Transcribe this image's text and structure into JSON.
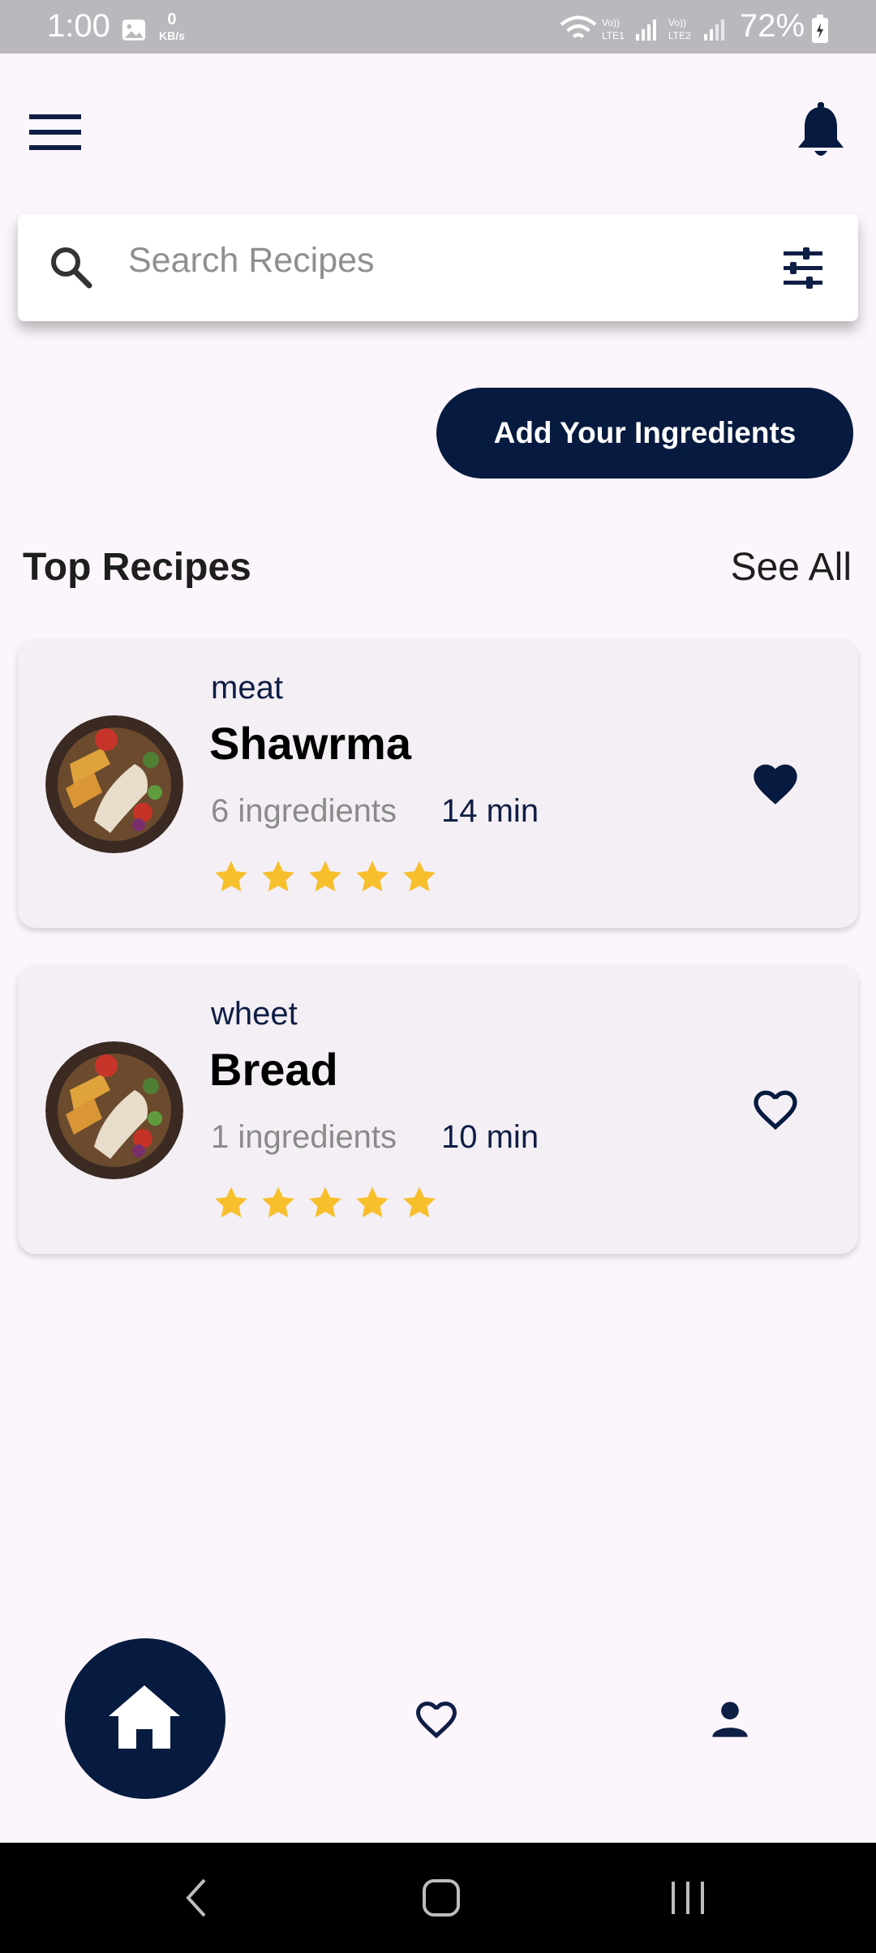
{
  "status_bar": {
    "time": "1:00",
    "kbs_value": "0",
    "kbs_unit": "KB/s",
    "battery": "72%"
  },
  "search": {
    "placeholder": "Search Recipes"
  },
  "actions": {
    "add_ingredients": "Add Your Ingredients"
  },
  "section": {
    "title": "Top Recipes",
    "see_all": "See All"
  },
  "recipes": [
    {
      "category": "meat",
      "name": "Shawrma",
      "ingredients": "6 ingredients",
      "time": "14 min",
      "rating": 5,
      "favorite": true
    },
    {
      "category": "wheet",
      "name": "Bread",
      "ingredients": "1 ingredients",
      "time": "10 min",
      "rating": 5,
      "favorite": false
    }
  ],
  "colors": {
    "primary": "#071a3f",
    "star": "#f8bf2d",
    "background": "#fcf6fc",
    "card": "#f3eff4"
  },
  "icons": {
    "menu": "menu-icon",
    "bell": "bell-icon",
    "search": "search-icon",
    "filter": "filter-icon",
    "home": "home-icon",
    "favorite": "heart-icon",
    "profile": "person-icon"
  }
}
